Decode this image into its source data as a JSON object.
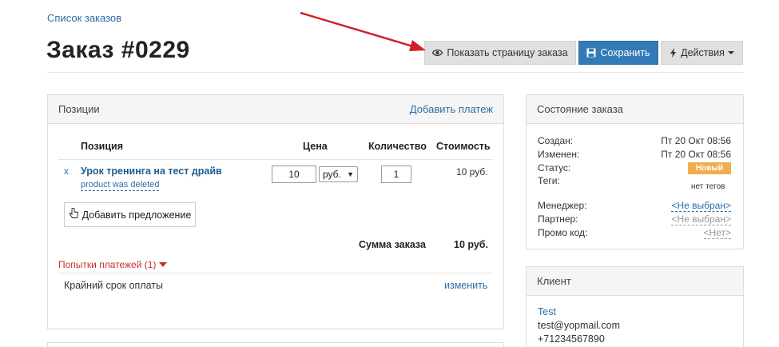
{
  "header": {
    "breadcrumb": "Список заказов",
    "title": "Заказ #0229",
    "show_page_label": "Показать страницу заказа",
    "save_label": "Сохранить",
    "actions_label": "Действия"
  },
  "positions": {
    "heading": "Позиции",
    "add_payment": "Добавить платеж",
    "columns": {
      "position": "Позиция",
      "price": "Цена",
      "quantity": "Количество",
      "cost": "Стоимость"
    },
    "item": {
      "remove": "x",
      "title": "Урок тренинга на тест драйв",
      "note": "product was deleted",
      "price": "10",
      "currency": "руб.",
      "quantity": "1",
      "cost": "10 руб."
    },
    "add_offer": "Добавить предложение",
    "total_label": "Сумма заказа",
    "total_value": "10 руб.",
    "payment_attempts": "Попытки платежей (1)",
    "deadline_label": "Крайний срок оплаты",
    "change_link": "изменить"
  },
  "order_state": {
    "heading": "Состояние заказа",
    "created_label": "Создан:",
    "created_value": "Пт 20 Окт 08:56",
    "modified_label": "Изменен:",
    "modified_value": "Пт 20 Окт 08:56",
    "status_label": "Статус:",
    "status_value": "Новый",
    "tags_label": "Теги:",
    "tags_value": "нет тегов",
    "manager_label": "Менеджер:",
    "manager_value": "<Не выбран>",
    "partner_label": "Партнер:",
    "partner_value": "<Не выбран>",
    "promo_label": "Промо код:",
    "promo_value": "<Нет>"
  },
  "client": {
    "heading": "Клиент",
    "name": "Test",
    "email": "test@yopmail.com",
    "phone": "+71234567890"
  },
  "colors": {
    "link": "#2d6da6",
    "primary": "#337ab7",
    "status_badge": "#f0ad4e",
    "alert": "#c9302c",
    "annotation_arrow": "#d0202a"
  }
}
